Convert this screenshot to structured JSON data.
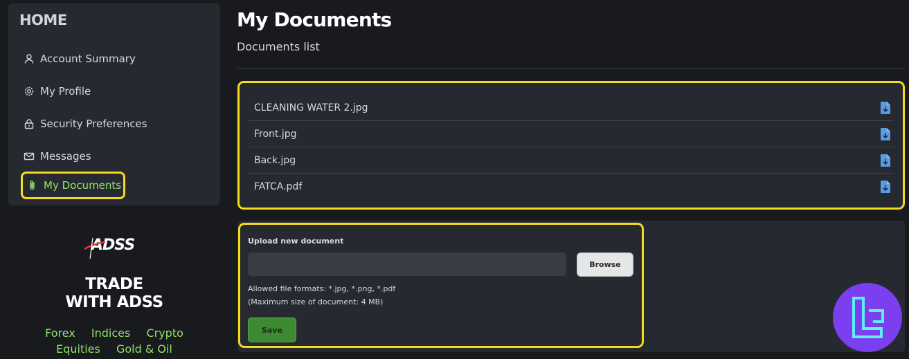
{
  "sidebar": {
    "home_label": "HOME",
    "items": [
      {
        "label": "Account Summary",
        "icon": "user-icon"
      },
      {
        "label": "My Profile",
        "icon": "gear-icon"
      },
      {
        "label": "Security Preferences",
        "icon": "lock-icon"
      },
      {
        "label": "Messages",
        "icon": "envelope-icon"
      },
      {
        "label": "My Documents",
        "icon": "paperclip-icon",
        "active": true
      }
    ]
  },
  "promo": {
    "logo_text": "ADSS",
    "tagline_line1": "TRADE",
    "tagline_line2": "WITH ADSS",
    "markets": [
      "Forex",
      "Indices",
      "Crypto",
      "Equities",
      "Gold & Oil"
    ]
  },
  "main": {
    "title": "My Documents",
    "subtitle": "Documents list",
    "documents": [
      {
        "name": "CLEANING WATER 2.jpg"
      },
      {
        "name": "Front.jpg"
      },
      {
        "name": "Back.jpg"
      },
      {
        "name": "FATCA.pdf"
      }
    ],
    "upload": {
      "title": "Upload new document",
      "browse_label": "Browse",
      "formats_hint": "Allowed file formats: *.jpg, *.png, *.pdf",
      "size_hint": "(Maximum size of document: 4 MB)",
      "save_label": "Save"
    }
  },
  "colors": {
    "accent_green": "#8fe36a",
    "highlight_yellow": "#f3dc1d",
    "save_green": "#3d8a32",
    "badge_purple": "#7b3ff0"
  }
}
